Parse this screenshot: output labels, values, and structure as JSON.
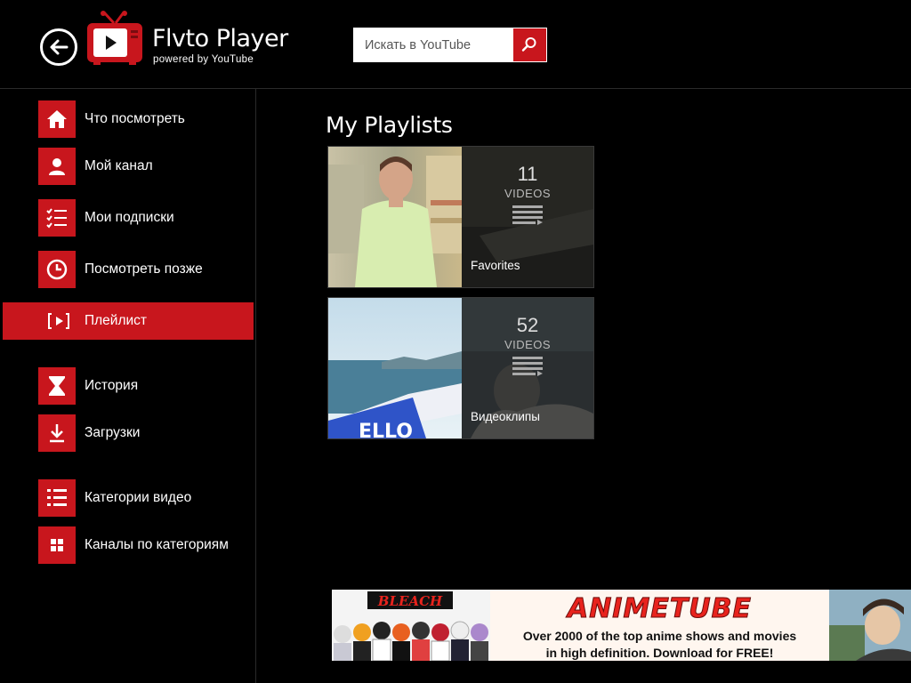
{
  "header": {
    "title": "Flvto Player",
    "subtitle": "powered by YouTube",
    "search_placeholder": "Искать в YouTube"
  },
  "sidebar": {
    "items": [
      {
        "label": "Что посмотреть",
        "icon": "home-icon"
      },
      {
        "label": "Мой канал",
        "icon": "user-icon"
      },
      {
        "label": "Мои подписки",
        "icon": "checklist-icon"
      },
      {
        "label": "Посмотреть позже",
        "icon": "clock-icon"
      },
      {
        "label": "Плейлист",
        "icon": "playlist-icon",
        "active": true
      },
      {
        "label": "История",
        "icon": "hourglass-icon"
      },
      {
        "label": "Загрузки",
        "icon": "download-icon"
      },
      {
        "label": "Категории видео",
        "icon": "list-icon"
      },
      {
        "label": "Каналы по категориям",
        "icon": "grid-icon"
      }
    ]
  },
  "main": {
    "title": "My Playlists",
    "playlists": [
      {
        "name": "Favorites",
        "count": "11",
        "unit": "VIDEOS"
      },
      {
        "name": "Видеоклипы",
        "count": "52",
        "unit": "VIDEOS"
      }
    ]
  },
  "ad": {
    "logo_text": "BLEACH",
    "title": "ANIMETUBE",
    "line1": "Over 2000 of the top anime shows and movies",
    "line2": "in high definition.  Download for FREE!"
  },
  "colors": {
    "accent": "#c8161d",
    "background": "#000000"
  }
}
